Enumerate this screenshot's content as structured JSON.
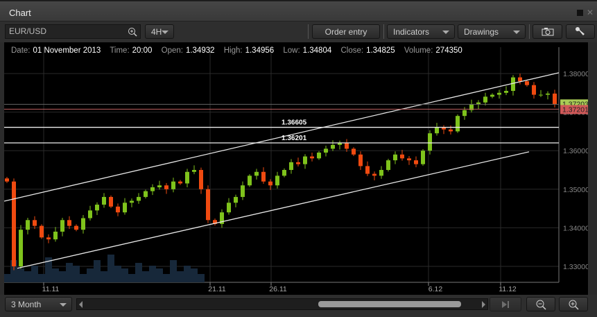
{
  "window": {
    "title": "Chart"
  },
  "toolbar": {
    "symbol": "EUR/USD",
    "interval": "4H",
    "order_entry": "Order entry",
    "indicators": "Indicators",
    "drawings": "Drawings"
  },
  "info": {
    "date_label": "Date:",
    "date": "01 November 2013",
    "time_label": "Time:",
    "time": "20:00",
    "open_label": "Open:",
    "open": "1.34932",
    "high_label": "High:",
    "high": "1.34956",
    "low_label": "Low:",
    "low": "1.34804",
    "close_label": "Close:",
    "close": "1.34825",
    "volume_label": "Volume:",
    "volume": "274350"
  },
  "bottom": {
    "range": "3 Month"
  },
  "colors": {
    "up": "#7fc31c",
    "down": "#f04a10",
    "bid": "#a9cc55",
    "ask": "#d05858"
  },
  "chart_data": {
    "type": "candlestick",
    "y_ticks": [
      "1.38000",
      "1.37000",
      "1.36000",
      "1.35000",
      "1.34000",
      "1.33000"
    ],
    "ylim": [
      1.326,
      1.3865
    ],
    "x_ticks": [
      {
        "label": "11.11",
        "idx": 5.3
      },
      {
        "label": "21.11",
        "idx": 29.3
      },
      {
        "label": "26.11",
        "idx": 38.1
      },
      {
        "label": "6.12",
        "idx": 60.8
      },
      {
        "label": "11.12",
        "idx": 71.2
      }
    ],
    "closes": [
      1.352,
      1.33,
      1.3395,
      1.342,
      1.3405,
      1.3375,
      1.337,
      1.339,
      1.342,
      1.3405,
      1.3395,
      1.3425,
      1.3445,
      1.346,
      1.348,
      1.3455,
      1.344,
      1.3465,
      1.347,
      1.348,
      1.3495,
      1.3505,
      1.351,
      1.35,
      1.352,
      1.3515,
      1.3545,
      1.355,
      1.35,
      1.342,
      1.341,
      1.344,
      1.3465,
      1.348,
      1.351,
      1.3535,
      1.3545,
      1.352,
      1.351,
      1.3535,
      1.355,
      1.357,
      1.3565,
      1.3585,
      1.358,
      1.3595,
      1.3605,
      1.3615,
      1.362,
      1.3605,
      1.359,
      1.356,
      1.354,
      1.3535,
      1.355,
      1.3575,
      1.359,
      1.358,
      1.3575,
      1.3565,
      1.36,
      1.3645,
      1.366,
      1.3655,
      1.365,
      1.369,
      1.3705,
      1.372,
      1.3725,
      1.374,
      1.3745,
      1.375,
      1.3755,
      1.379,
      1.378,
      1.377,
      1.3745,
      1.3745,
      1.3748,
      1.372
    ],
    "volumes": [
      3,
      8,
      5,
      4,
      6,
      3,
      9,
      5,
      4,
      7,
      6,
      3,
      5,
      8,
      4,
      10,
      6,
      5,
      3,
      7,
      4,
      6,
      5,
      3,
      8,
      4,
      6,
      5,
      3
    ],
    "hlines": [
      {
        "label": "1.36605",
        "price": 1.36605
      },
      {
        "label": "1.36201",
        "price": 1.36201
      }
    ],
    "trendlines": [
      {
        "from": [
          -0.4,
          1.3469
        ],
        "to": [
          79.6,
          1.3802
        ]
      },
      {
        "from": [
          1.5,
          1.3295
        ],
        "to": [
          75.3,
          1.3597
        ]
      }
    ],
    "bid": "1.37203",
    "ask": "1.37201",
    "bid_price": 1.37203,
    "ask_price": 1.37201
  }
}
